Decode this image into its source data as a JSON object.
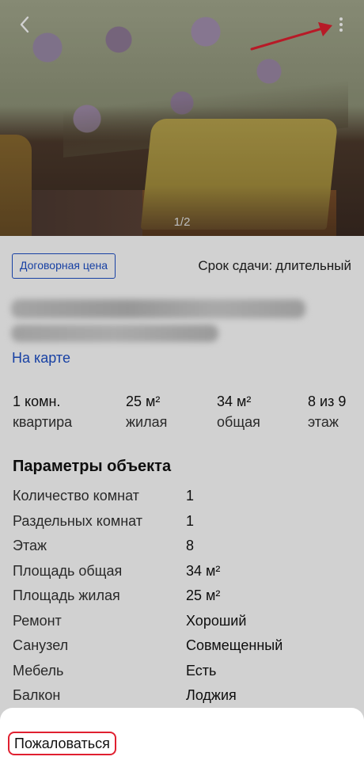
{
  "gallery": {
    "counter": "1/2",
    "back_icon": "chevron-left-icon",
    "more_icon": "more-vertical-icon"
  },
  "listing": {
    "price_badge": "Договорная цена",
    "term_label": "Срок сдачи:",
    "term_value": "длительный",
    "map_link": "На карте"
  },
  "stats": [
    {
      "value": "1 комн.",
      "label": "квартира"
    },
    {
      "value": "25 м²",
      "label": "жилая"
    },
    {
      "value": "34 м²",
      "label": "общая"
    },
    {
      "value": "8 из 9",
      "label": "этаж"
    }
  ],
  "params": {
    "title": "Параметры объекта",
    "rows": [
      {
        "key": "Количество комнат",
        "value": "1"
      },
      {
        "key": "Раздельных комнат",
        "value": "1"
      },
      {
        "key": "Этаж",
        "value": "8"
      },
      {
        "key": "Площадь общая",
        "value": "34 м²"
      },
      {
        "key": "Площадь жилая",
        "value": "25 м²"
      },
      {
        "key": "Ремонт",
        "value": "Хороший"
      },
      {
        "key": "Санузел",
        "value": "Совмещенный"
      },
      {
        "key": "Мебель",
        "value": "Есть"
      },
      {
        "key": "Балкон",
        "value": "Лоджия"
      }
    ]
  },
  "sheet": {
    "report_label": "Пожаловаться"
  },
  "colors": {
    "link": "#1e50c8",
    "annotation": "#e02030",
    "overlay": "rgba(0,0,0,0.18)"
  }
}
